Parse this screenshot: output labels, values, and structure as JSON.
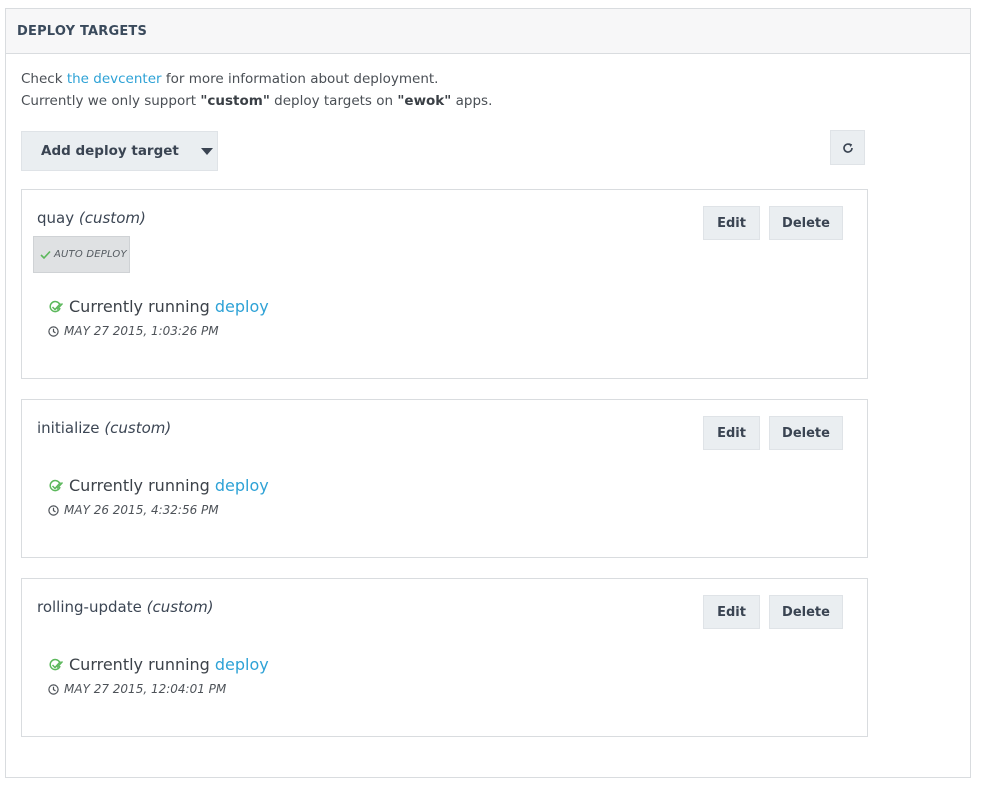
{
  "panel": {
    "title": "DEPLOY TARGETS"
  },
  "intro": {
    "line1_prefix": "Check ",
    "line1_link": "the devcenter",
    "line1_suffix": " for more information about deployment.",
    "line2_prefix": "Currently we only support ",
    "line2_bold1": "\"custom\"",
    "line2_mid": " deploy targets on ",
    "line2_bold2": "\"ewok\"",
    "line2_suffix": " apps."
  },
  "toolbar": {
    "add_label": "Add deploy target",
    "refresh_icon": "refresh-icon"
  },
  "targets": [
    {
      "name": "quay",
      "kind": "(custom)",
      "auto_deploy": "AUTO DEPLOY",
      "status_text": "Currently running",
      "status_link": "deploy",
      "timestamp": "MAY 27 2015, 1:03:26 PM",
      "edit_label": "Edit",
      "delete_label": "Delete"
    },
    {
      "name": "initialize",
      "kind": "(custom)",
      "status_text": "Currently running",
      "status_link": "deploy",
      "timestamp": "MAY 26 2015, 4:32:56 PM",
      "edit_label": "Edit",
      "delete_label": "Delete"
    },
    {
      "name": "rolling-update",
      "kind": "(custom)",
      "status_text": "Currently running",
      "status_link": "deploy",
      "timestamp": "MAY 27 2015, 12:04:01 PM",
      "edit_label": "Edit",
      "delete_label": "Delete"
    }
  ],
  "colors": {
    "link": "#2ea2d6",
    "success": "#5cb85c",
    "button_bg": "#eaeef1"
  }
}
